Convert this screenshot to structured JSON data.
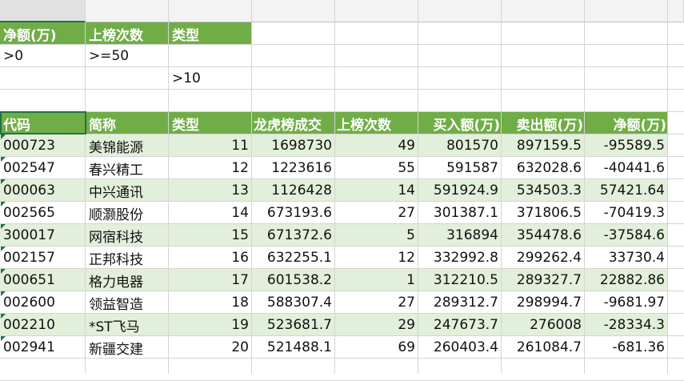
{
  "columns": [
    "J",
    "K",
    "L",
    "M",
    "N",
    "O",
    "P",
    "Q"
  ],
  "criteria": {
    "headers": [
      "净额(万)",
      "上榜次数",
      "类型"
    ],
    "row1": [
      ">0",
      ">=50",
      ""
    ],
    "row2": [
      "",
      "",
      ">10"
    ]
  },
  "table": {
    "headers": [
      "代码",
      "简称",
      "类型",
      "龙虎榜成交",
      "上榜次数",
      "买入额(万)",
      "卖出额(万)",
      "净额(万)"
    ],
    "rows": [
      [
        "000723",
        "美锦能源",
        "11",
        "1698730",
        "49",
        "801570",
        "897159.5",
        "-95589.5"
      ],
      [
        "002547",
        "春兴精工",
        "12",
        "1223616",
        "55",
        "591587",
        "632028.6",
        "-40441.6"
      ],
      [
        "000063",
        "中兴通讯",
        "13",
        "1126428",
        "14",
        "591924.9",
        "534503.3",
        "57421.64"
      ],
      [
        "002565",
        "顺灏股份",
        "14",
        "673193.6",
        "27",
        "301387.1",
        "371806.5",
        "-70419.3"
      ],
      [
        "300017",
        "网宿科技",
        "15",
        "671372.6",
        "5",
        "316894",
        "354478.6",
        "-37584.6"
      ],
      [
        "002157",
        "正邦科技",
        "16",
        "632255.1",
        "12",
        "332992.8",
        "299262.4",
        "33730.4"
      ],
      [
        "000651",
        "格力电器",
        "17",
        "601538.2",
        "1",
        "312210.5",
        "289327.7",
        "22882.86"
      ],
      [
        "002600",
        "领益智造",
        "18",
        "588307.4",
        "27",
        "289312.7",
        "298994.7",
        "-9681.97"
      ],
      [
        "002210",
        "*ST飞马",
        "19",
        "523681.7",
        "29",
        "247673.7",
        "276008",
        "-28334.3"
      ],
      [
        "002941",
        "新疆交建",
        "20",
        "521488.1",
        "69",
        "260403.4",
        "261084.7",
        "-681.36"
      ]
    ]
  },
  "colors": {
    "header_green": "#70ad47",
    "band_green": "#e2efda",
    "grid": "#d4d4d4",
    "select": "#217346"
  }
}
